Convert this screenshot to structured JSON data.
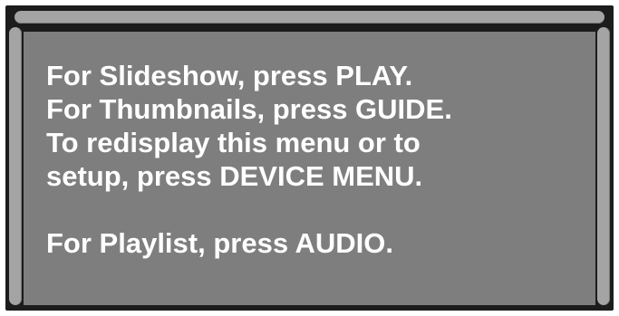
{
  "menu": {
    "lines": [
      "For Slideshow, press PLAY.",
      "For Thumbnails, press GUIDE.",
      "To redisplay this menu or to",
      "setup, press DEVICE MENU."
    ],
    "playlist_line": "For Playlist, press AUDIO."
  },
  "colors": {
    "panel": "#7e7e7e",
    "frame": "#1c1c1c",
    "bezel": "#a4a4a4",
    "text": "#ffffff"
  }
}
